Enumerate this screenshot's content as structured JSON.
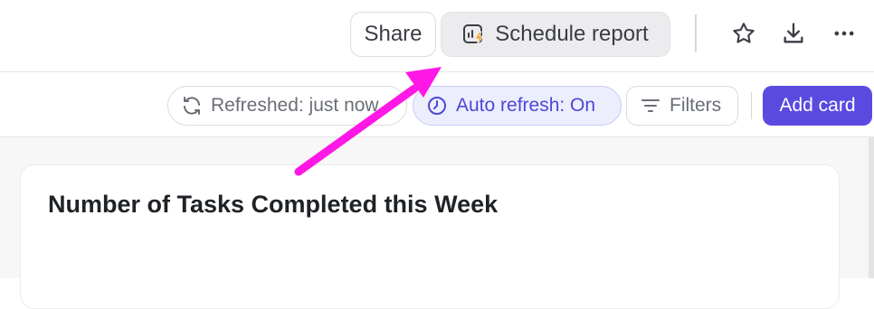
{
  "header": {
    "share_label": "Share",
    "schedule_label": "Schedule report",
    "icons": [
      "schedule-report-icon",
      "star-icon",
      "download-icon",
      "more-options-icon"
    ]
  },
  "toolbar": {
    "refreshed_label": "Refreshed: just now",
    "auto_refresh_label": "Auto refresh: On",
    "filters_label": "Filters",
    "add_card_label": "Add card",
    "icons": [
      "refresh-icon",
      "clock-icon",
      "filter-icon"
    ]
  },
  "dashboard": {
    "card_title": "Number of Tasks Completed this Week"
  },
  "annotation": {
    "arrow_color": "#ff17e6"
  },
  "colors": {
    "accent": "#5b4ae0",
    "auto_refresh_bg": "#eceefd",
    "auto_refresh_text": "#4f46d6"
  }
}
